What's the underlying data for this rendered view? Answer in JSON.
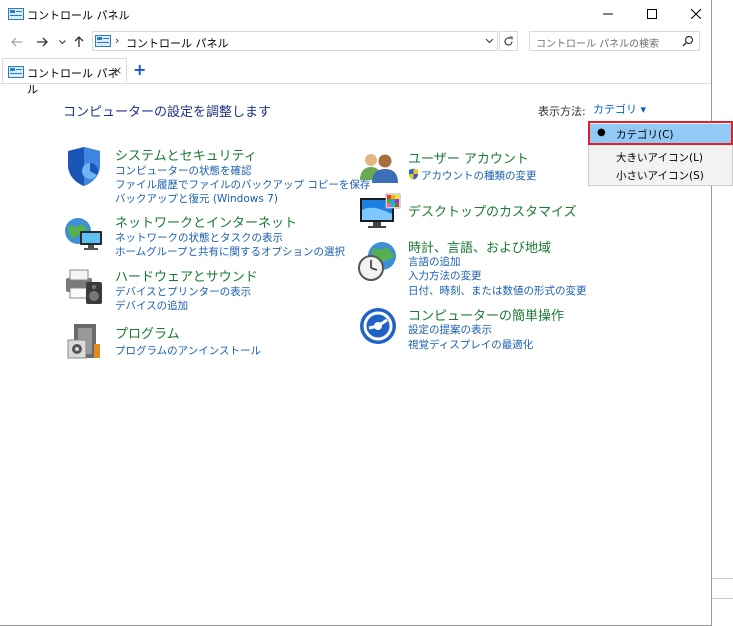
{
  "window": {
    "title": "コントロール パネル"
  },
  "address": {
    "separator": "›",
    "path": "コントロール パネル"
  },
  "search": {
    "placeholder": "コントロール パネルの検索"
  },
  "tab": {
    "label": "コントロール パネル",
    "close": "×",
    "add": "+"
  },
  "heading": "コンピューターの設定を調整します",
  "view_by": {
    "label": "表示方法:",
    "value": "カテゴリ ▾"
  },
  "dropdown": {
    "items": [
      {
        "label": "カテゴリ(C)",
        "selected": true,
        "bullet": "●"
      },
      {
        "label": "大きいアイコン(L)",
        "selected": false
      },
      {
        "label": "小さいアイコン(S)",
        "selected": false
      }
    ]
  },
  "categories_left": [
    {
      "title": "システムとセキュリティ",
      "icon": "shield-icon",
      "links": [
        "コンピューターの状態を確認",
        "ファイル履歴でファイルのバックアップ コピーを保存",
        "バックアップと復元 (Windows 7)"
      ]
    },
    {
      "title": "ネットワークとインターネット",
      "icon": "network-globe-icon",
      "links": [
        "ネットワークの状態とタスクの表示",
        "ホームグループと共有に関するオプションの選択"
      ]
    },
    {
      "title": "ハードウェアとサウンド",
      "icon": "printer-speaker-icon",
      "links": [
        "デバイスとプリンターの表示",
        "デバイスの追加"
      ]
    },
    {
      "title": "プログラム",
      "icon": "programs-icon",
      "links": [
        "プログラムのアンインストール"
      ]
    }
  ],
  "categories_right": [
    {
      "title": "ユーザー アカウント",
      "icon": "users-icon",
      "links": [
        "アカウントの種類の変更"
      ]
    },
    {
      "title": "デスクトップのカスタマイズ",
      "icon": "desktop-palette-icon",
      "links": []
    },
    {
      "title": "時計、言語、および地域",
      "icon": "clock-globe-icon",
      "links": [
        "言語の追加",
        "入力方法の変更",
        "日付、時刻、または数値の形式の変更"
      ]
    },
    {
      "title": "コンピューターの簡単操作",
      "icon": "accessibility-icon",
      "links": [
        "設定の提案の表示",
        "視覚ディスプレイの最適化"
      ]
    }
  ],
  "colors": {
    "title_green": "#1a7a33",
    "link_blue": "#1a5fb4",
    "heading_blue": "#1e3287",
    "highlight_red": "#e0202a",
    "selected_bg": "#91c9f7"
  }
}
